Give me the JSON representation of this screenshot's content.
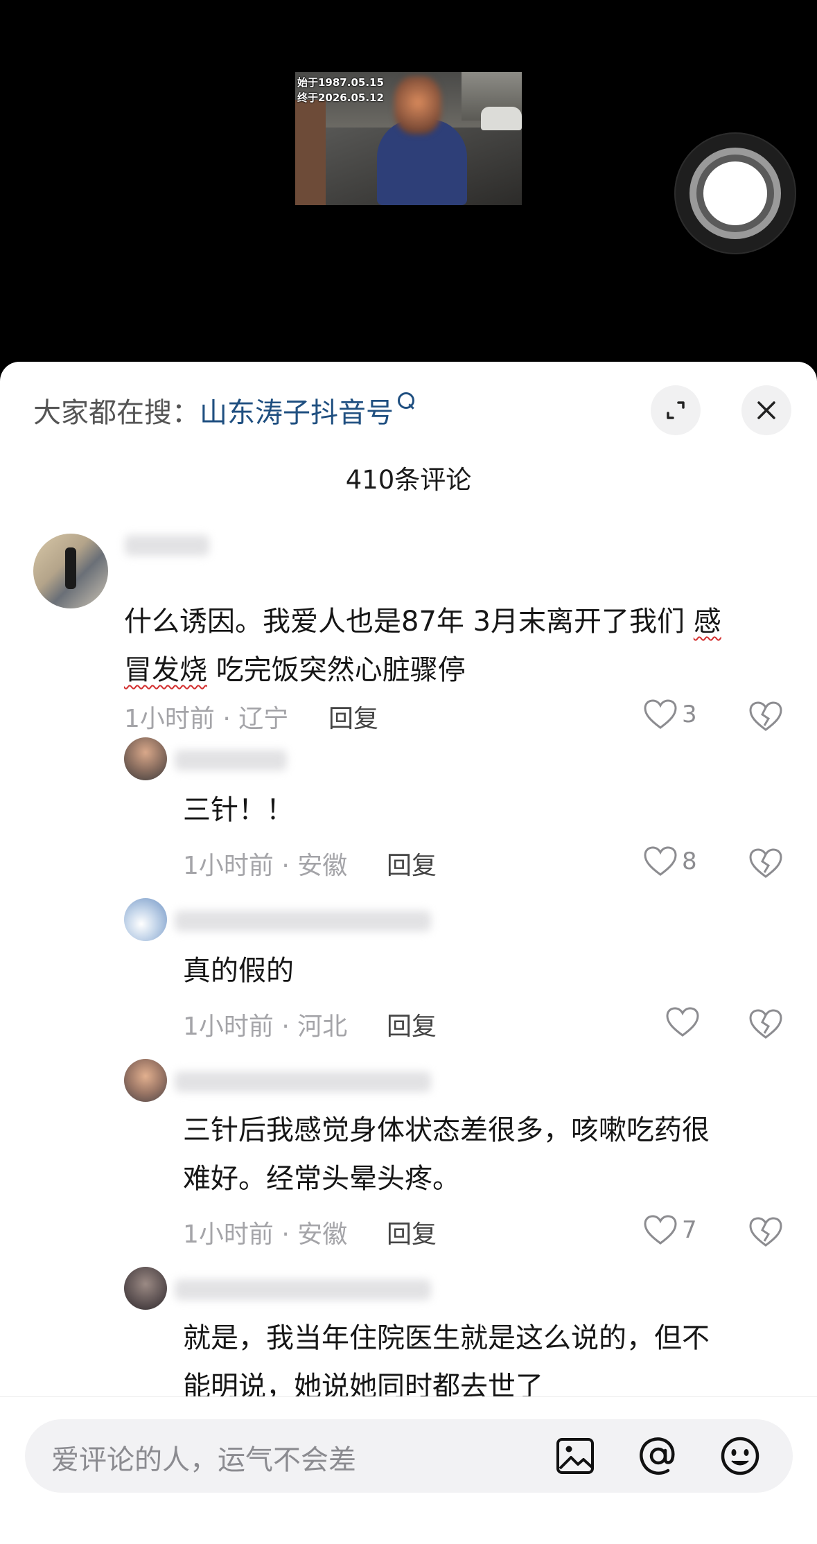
{
  "video": {
    "caption_line1": "始于1987.05.15",
    "caption_line2": "终于2026.05.12"
  },
  "header": {
    "search_prefix": "大家都在搜：",
    "search_term": "山东涛子抖音号",
    "comment_count": "410条评论"
  },
  "comments": [
    {
      "text_line1_a": "什么诱因。我爱人也是87年 3月末离开了我们 ",
      "text_line1_b": "感",
      "text_line2_a": "冒发烧",
      "text_line2_b": " 吃完饭突然心脏骤停",
      "meta": "1小时前 · 辽宁",
      "reply": "回复",
      "likes": "3"
    },
    {
      "text_line1": "三针！！",
      "meta": "1小时前 · 安徽",
      "reply": "回复",
      "likes": "8"
    },
    {
      "text_line1": "真的假的",
      "meta": "1小时前 · 河北",
      "reply": "回复",
      "likes": ""
    },
    {
      "text_line1": "三针后我感觉身体状态差很多，咳嗽吃药很",
      "text_line2": "难好。经常头晕头疼。",
      "meta": "1小时前 · 安徽",
      "reply": "回复",
      "likes": "7"
    },
    {
      "text_line1": "就是，我当年住院医生就是这么说的，但不",
      "text_line2": "能明说，她说她同时都去世了"
    }
  ],
  "input": {
    "placeholder": "爱评论的人，运气不会差"
  },
  "icons": {
    "expand": "expand-icon",
    "close": "close-icon",
    "search": "search-icon",
    "like": "heart-icon",
    "dislike": "broken-heart-icon",
    "image": "image-icon",
    "mention": "at-icon",
    "emoji": "emoji-icon"
  }
}
